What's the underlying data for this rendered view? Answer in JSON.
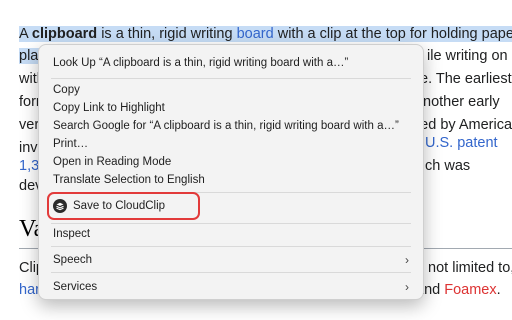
{
  "article": {
    "line1": {
      "a": "A ",
      "bold": "clipboard",
      "b": " is a thin, rigid writing ",
      "link": "board",
      "c": " with a clip at the top for holding paper in"
    },
    "line2_left": "plac",
    "line2_right": "ile writing on it",
    "line3_left": "with",
    "line3_right": "e. The earliest",
    "line4_left": "forn",
    "line4_right": "nother early",
    "line5_left": "vers",
    "line5_right": "ented by American",
    "line6_left": "inve",
    "line6_link": "U.S. patent",
    "line7_left": "1,39",
    "line7_right": "ch was",
    "line8_left": "dev",
    "heading": "Va",
    "line9_left": "Clip",
    "line9_right": "t not limited to,",
    "line10_left": "hard",
    "line10_right_text": "and ",
    "line10_right_link": "Foamex",
    "line10_end": "."
  },
  "context_menu": {
    "look_up": "Look Up “A clipboard is a thin, rigid writing board with a…”",
    "copy": "Copy",
    "copy_link": "Copy Link to Highlight",
    "search_google": "Search Google for “A clipboard is a thin, rigid writing board with a…”",
    "print": "Print…",
    "reading_mode": "Open in Reading Mode",
    "translate": "Translate Selection to English",
    "save_cloudclip": "Save to CloudClip",
    "inspect": "Inspect",
    "speech": "Speech",
    "services": "Services",
    "chevron": "›"
  },
  "colors": {
    "selection": "#c6dcf5",
    "link": "#3366cc",
    "redlink": "#d33333",
    "highlight_ring": "#e23a3a"
  },
  "icons": {
    "cloudclip": "cloudclip-icon",
    "submenu": "chevron-right-icon"
  }
}
